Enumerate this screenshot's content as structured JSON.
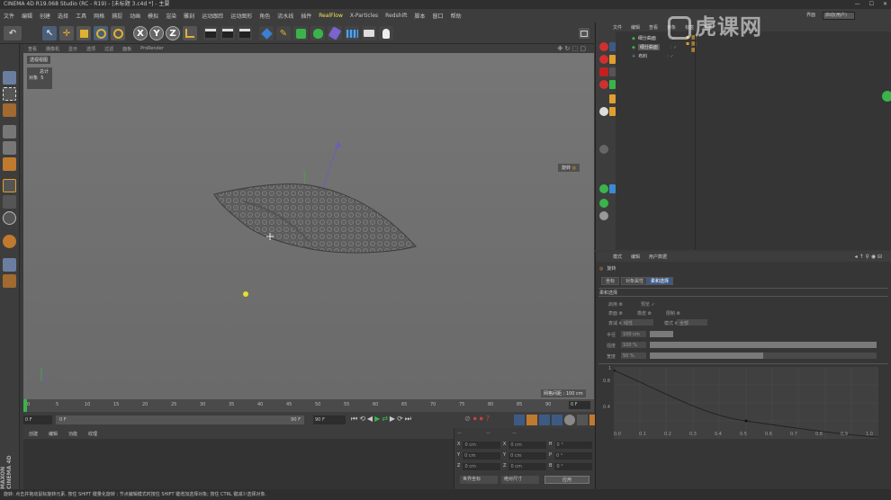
{
  "window": {
    "title": "CINEMA 4D R19.068 Studio (RC - R19) - [未标题 3.c4d *] - 主要"
  },
  "menu": {
    "items": [
      "文件",
      "编辑",
      "创建",
      "选择",
      "工具",
      "网格",
      "捕捉",
      "动画",
      "模拟",
      "渲染",
      "雕刻",
      "运动跟踪",
      "运动图形",
      "角色",
      "流水线",
      "插件"
    ],
    "highlight_item": "RealFlow",
    "extra_items": [
      "X-Particles",
      "Redshift",
      "脚本",
      "窗口",
      "帮助"
    ],
    "layout_label": "界面",
    "layout_value": "启动(用户)"
  },
  "toolbar": {
    "axis_x": "X",
    "axis_y": "Y",
    "axis_z": "Z"
  },
  "viewport": {
    "menu": [
      "查看",
      "摄像机",
      "显示",
      "选项",
      "过滤",
      "面板",
      "ProRender"
    ],
    "label": "透视视图",
    "hud_label": "总计",
    "hud_object_label": "对象",
    "hud_object_value": "5",
    "rotate_tag": "旋转",
    "grid_info": "网格间距 : 100 cm"
  },
  "timeline": {
    "ticks": [
      "0",
      "5",
      "10",
      "15",
      "20",
      "25",
      "30",
      "35",
      "40",
      "45",
      "50",
      "55",
      "60",
      "65",
      "70",
      "75",
      "80",
      "85",
      "90"
    ],
    "frame_end_right": "0 F"
  },
  "transport": {
    "start_frame": "0 F",
    "current_frame": "0 F",
    "mid_frame": "90 F",
    "end_frame": "90 F"
  },
  "material": {
    "menu": [
      "创建",
      "编辑",
      "功能",
      "纹理"
    ]
  },
  "coords": {
    "rows": [
      {
        "a": "X",
        "av": "0 cm",
        "b": "X",
        "bv": "0 cm",
        "c": "H",
        "cv": "0 °"
      },
      {
        "a": "Y",
        "av": "0 cm",
        "b": "Y",
        "bv": "0 cm",
        "c": "P",
        "cv": "0 °"
      },
      {
        "a": "Z",
        "av": "0 cm",
        "b": "Z",
        "bv": "0 cm",
        "c": "B",
        "cv": "0 °"
      }
    ],
    "mode": "世界坐标",
    "scale_mode": "绝对尺寸",
    "apply": "应用"
  },
  "objects": {
    "menu": [
      "文件",
      "编辑",
      "查看",
      "对象",
      "标签",
      "书签"
    ],
    "rows": [
      {
        "name": "细分曲面",
        "selected": false
      },
      {
        "name": "细分曲面",
        "selected": true
      },
      {
        "name": "布料",
        "selected": false
      }
    ]
  },
  "attributes": {
    "menu": [
      "模式",
      "编辑",
      "用户数据"
    ],
    "object_name": "旋转",
    "tabs": [
      "坐标",
      "对象属性",
      "柔和选择"
    ],
    "active_tab": 2,
    "section": "柔和选择",
    "rows": {
      "enable": "启用",
      "enable_check": "✓",
      "preview": "预览",
      "preview_check": "✓",
      "surface": "表面",
      "rubber": "橡皮",
      "restrict": "限制",
      "type_label": "衰减",
      "type_value": "线性",
      "mode_label": "模式",
      "mode_value": "全部",
      "radius_label": "半径",
      "radius_value": "100 cm",
      "strength_label": "强度",
      "strength_value": "100 %",
      "width_label": "宽度",
      "width_value": "50 %"
    },
    "graph": {
      "y_ticks": [
        "1",
        "0.8",
        "0.4"
      ],
      "x_ticks": [
        "0.0",
        "0.1",
        "0.2",
        "0.3",
        "0.4",
        "0.5",
        "0.6",
        "0.7",
        "0.8",
        "0.9",
        "1.0"
      ]
    }
  },
  "status": {
    "text": "旋转: 点击并拖动鼠标旋转元素. 按住 SHIFT 键量化旋转 : 节点编辑模式时按住 SHIFT 键增加选择对象; 按住 CTRL 键减少选择对象."
  },
  "watermark": {
    "text": "虎课网"
  },
  "branding": {
    "text": "MAXON CINEMA 4D"
  },
  "colors": {
    "accent_blue": "#3d5a85",
    "highlight_yellow": "#f2e35c",
    "ui_bg": "#3d3d3d"
  }
}
